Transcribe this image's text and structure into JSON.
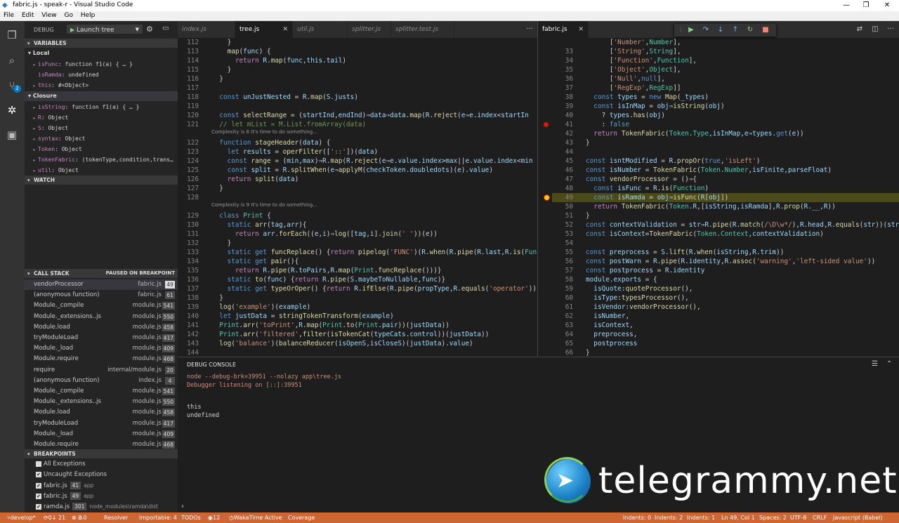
{
  "window": {
    "title": "fabric.js - speak-r - Visual Studio Code",
    "controls": [
      "—",
      "❐",
      "✕"
    ]
  },
  "menu": [
    "File",
    "Edit",
    "View",
    "Go",
    "Help"
  ],
  "debug": {
    "label": "DEBUG",
    "config": "Launch tree"
  },
  "variables": {
    "header": "VARIABLES",
    "local_label": "Local",
    "local": [
      {
        "name": "isFunc",
        "value": "function f1(a) { … }",
        "arrow": true
      },
      {
        "name": "isRamda",
        "value": "undefined",
        "arrow": false
      },
      {
        "name": "this",
        "value": "#<Object>",
        "arrow": true
      }
    ],
    "closure_label": "Closure",
    "closure": [
      {
        "name": "isString",
        "value": "function f1(a) { … }"
      },
      {
        "name": "R",
        "value": "Object"
      },
      {
        "name": "S",
        "value": "Object"
      },
      {
        "name": "syntax",
        "value": "Object"
      },
      {
        "name": "Token",
        "value": "Object"
      },
      {
        "name": "TokenFabric",
        "value": "(tokenType,condition,trans…"
      },
      {
        "name": "util",
        "value": "Object"
      }
    ]
  },
  "watch": {
    "header": "WATCH"
  },
  "callstack": {
    "header": "CALL STACK",
    "status": "PAUSED ON BREAKPOINT",
    "frames": [
      {
        "name": "vendorProcessor",
        "file": "fabric.js",
        "line": "49"
      },
      {
        "name": "(anonymous function)",
        "file": "fabric.js",
        "line": "61"
      },
      {
        "name": "Module._compile",
        "file": "module.js",
        "line": "541"
      },
      {
        "name": "Module._extensions..js",
        "file": "module.js",
        "line": "550"
      },
      {
        "name": "Module.load",
        "file": "module.js",
        "line": "458"
      },
      {
        "name": "tryModuleLoad",
        "file": "module.js",
        "line": "417"
      },
      {
        "name": "Module._load",
        "file": "module.js",
        "line": "409"
      },
      {
        "name": "Module.require",
        "file": "module.js",
        "line": "468"
      },
      {
        "name": "require",
        "file": "internal/module.js",
        "line": "20"
      },
      {
        "name": "(anonymous function)",
        "file": "index.js",
        "line": "4"
      },
      {
        "name": "Module._compile",
        "file": "module.js",
        "line": "541"
      },
      {
        "name": "Module._extensions..js",
        "file": "module.js",
        "line": "550"
      },
      {
        "name": "Module.load",
        "file": "module.js",
        "line": "458"
      },
      {
        "name": "tryModuleLoad",
        "file": "module.js",
        "line": "417"
      },
      {
        "name": "Module._load",
        "file": "module.js",
        "line": "409"
      },
      {
        "name": "Module.require",
        "file": "module.js",
        "line": "468"
      }
    ]
  },
  "breakpoints": {
    "header": "BREAKPOINTS",
    "items": [
      {
        "label": "All Exceptions",
        "checked": false,
        "line": "",
        "path": ""
      },
      {
        "label": "Uncaught Exceptions",
        "checked": true,
        "line": "",
        "path": ""
      },
      {
        "label": "fabric.js",
        "checked": true,
        "line": "41",
        "path": "app"
      },
      {
        "label": "fabric.js",
        "checked": true,
        "line": "49",
        "path": "app"
      },
      {
        "label": "ramda.js",
        "checked": true,
        "line": "301",
        "path": "node_modules\\ramda\\dist"
      }
    ]
  },
  "left_tabs": [
    "index.js",
    "tree.js",
    "util.js",
    "splitter.js",
    "splitter.test.js"
  ],
  "right_tabs": [
    "fabric.js"
  ],
  "left_lines": [
    {
      "n": "112",
      "code": "    }",
      "type": "code"
    },
    {
      "n": "113",
      "code": "    map(func) {",
      "type": "code"
    },
    {
      "n": "114",
      "code": "      return R.map(func,this.tail)",
      "type": "code"
    },
    {
      "n": "115",
      "code": "    }",
      "type": "code"
    },
    {
      "n": "116",
      "code": "  }",
      "type": "code"
    },
    {
      "n": "117",
      "code": "",
      "type": "code"
    },
    {
      "n": "118",
      "code": "  const unJustNested = R.map(S.justs)",
      "type": "code"
    },
    {
      "n": "119",
      "code": "",
      "type": "code"
    },
    {
      "n": "120",
      "code": "  const selectRange = (startInd,endInd)⇒data⇒data.map(R.reject(e⇒e.index<startIn",
      "type": "code"
    },
    {
      "n": "121",
      "code": "  // let mList = M.List.fromArray(data)",
      "type": "comment"
    },
    {
      "n": "",
      "code": "Complexity is 6 It's time to do something...",
      "type": "lens"
    },
    {
      "n": "122",
      "code": "  function stageHeader(data) {",
      "type": "code"
    },
    {
      "n": "123",
      "code": "    let results = operFilter(['::'])(data)",
      "type": "code"
    },
    {
      "n": "124",
      "code": "    const range = (min,max)⇒R.map(R.reject(e⇒e.value.index>max||e.value.index<min",
      "type": "code"
    },
    {
      "n": "125",
      "code": "    const split = R.splitWhen(e⇒applyM(checkToken.doubledots)(e).value)",
      "type": "code"
    },
    {
      "n": "126",
      "code": "    return split(data)",
      "type": "code"
    },
    {
      "n": "127",
      "code": "  }",
      "type": "code"
    },
    {
      "n": "128",
      "code": "",
      "type": "code"
    },
    {
      "n": "",
      "code": "Complexity is 9 It's time to do something...",
      "type": "lens"
    },
    {
      "n": "129",
      "code": "  class Print {",
      "type": "code"
    },
    {
      "n": "130",
      "code": "    static arr(tag,arr){",
      "type": "code"
    },
    {
      "n": "131",
      "code": "      return arr.forEach((e,i)⇒log([tag,i].join(' '))(e))",
      "type": "code"
    },
    {
      "n": "132",
      "code": "    }",
      "type": "code"
    },
    {
      "n": "133",
      "code": "    static get funcReplace() {return pipelog('FUNC')(R.when(R.pipe(R.last,R.is(Func",
      "type": "code"
    },
    {
      "n": "134",
      "code": "    static get pair(){",
      "type": "code"
    },
    {
      "n": "135",
      "code": "      return R.pipe(R.toPairs,R.map(Print.funcReplace()))}",
      "type": "code"
    },
    {
      "n": "136",
      "code": "    static to(func) {return R.pipe(S.maybeToNullable,func)}",
      "type": "code"
    },
    {
      "n": "137",
      "code": "    static get typeOrOper() {return R.ifElse(R.pipe(propType,R.equals('operator'))",
      "type": "code"
    },
    {
      "n": "138",
      "code": "  }",
      "type": "code"
    },
    {
      "n": "139",
      "code": "  log('example')(example)",
      "type": "code"
    },
    {
      "n": "140",
      "code": "  let justData = stringTokenTransform(example)",
      "type": "code"
    },
    {
      "n": "141",
      "code": "  Print.arr('toPrint',R.map(Print.to(Print.pair))(justData))",
      "type": "code"
    },
    {
      "n": "142",
      "code": "  Print.arr('filtered',filter(isTokenCat(typeCats.control))(justData))",
      "type": "code"
    },
    {
      "n": "143",
      "code": "  log('balance')(balanceReducer(isOpenS,isCloseS)(justData).value)",
      "type": "code"
    },
    {
      "n": "144",
      "code": "",
      "type": "code"
    }
  ],
  "right_lines": [
    {
      "n": "",
      "code": "      ['Number',Number],",
      "type": "code"
    },
    {
      "n": "33",
      "code": "      ['String',String],",
      "type": "code"
    },
    {
      "n": "34",
      "code": "      ['Function',Function],",
      "type": "code"
    },
    {
      "n": "35",
      "code": "      ['Object',Object],",
      "type": "code"
    },
    {
      "n": "36",
      "code": "      ['Null',null],",
      "type": "code"
    },
    {
      "n": "37",
      "code": "      ['RegExp',RegExp]]",
      "type": "code"
    },
    {
      "n": "38",
      "code": "  const types = new Map(_types)",
      "type": "code"
    },
    {
      "n": "39",
      "code": "  const isInMap = obj⇒isString(obj)",
      "type": "code"
    },
    {
      "n": "40",
      "code": "    ? types.has(obj)",
      "type": "code"
    },
    {
      "n": "41",
      "code": "    : false",
      "type": "code"
    },
    {
      "n": "42",
      "code": "  return TokenFabric(Token.Type,isInMap,e⇒types.get(e))",
      "type": "code"
    },
    {
      "n": "43",
      "code": "}",
      "type": "code"
    },
    {
      "n": "44",
      "code": "",
      "type": "code"
    },
    {
      "n": "45",
      "code": "const isntModified = R.propOr(true,'isLeft')",
      "type": "code"
    },
    {
      "n": "46",
      "code": "const isNumber = TokenFabric(Token.Number,isFinite,parseFloat)",
      "type": "code"
    },
    {
      "n": "47",
      "code": "const vendorProcessor = ()⇒{",
      "type": "code"
    },
    {
      "n": "48",
      "code": "  const isFunc = R.is(Function)",
      "type": "code"
    },
    {
      "n": "49",
      "code": "  const isRamda = obj⇒isFunc(R[obj])",
      "type": "current"
    },
    {
      "n": "50",
      "code": "  return TokenFabric(Token.R,[isString,isRamda],R.prop(R.__,R))",
      "type": "code"
    },
    {
      "n": "51",
      "code": "}",
      "type": "code"
    },
    {
      "n": "52",
      "code": "const contextValidation = str⇒R.pipe(R.match(/\\D\\w*/),R.head,R.equals(str))(str",
      "type": "code"
    },
    {
      "n": "53",
      "code": "const isContext=TokenFabric(Token.Context,contextValidation)",
      "type": "code"
    },
    {
      "n": "54",
      "code": "",
      "type": "code"
    },
    {
      "n": "55",
      "code": "const preprocess = S.lift(R.when(isString,R.trim))",
      "type": "code"
    },
    {
      "n": "56",
      "code": "const postWarn = R.pipe(R.identity,R.assoc('warning','left-sided value'))",
      "type": "code"
    },
    {
      "n": "57",
      "code": "const postprocess = R.identity",
      "type": "code"
    },
    {
      "n": "58",
      "code": "module.exports = {",
      "type": "code"
    },
    {
      "n": "59",
      "code": "  isQuote:quoteProcessor(),",
      "type": "code"
    },
    {
      "n": "60",
      "code": "  isType:typesProcessor(),",
      "type": "code"
    },
    {
      "n": "61",
      "code": "  isVendor:vendorProcessor(),",
      "type": "code"
    },
    {
      "n": "62",
      "code": "  isNumber,",
      "type": "code"
    },
    {
      "n": "63",
      "code": "  isContext,",
      "type": "code"
    },
    {
      "n": "64",
      "code": "  preprocess,",
      "type": "code"
    },
    {
      "n": "65",
      "code": "  postprocess",
      "type": "code"
    },
    {
      "n": "66",
      "code": "}",
      "type": "code"
    }
  ],
  "console": {
    "title": "DEBUG CONSOLE",
    "lines": [
      {
        "text": "node --debug-brk=39951 --nolazy app\\tree.js",
        "color": "#ce9178"
      },
      {
        "text": "Debugger listening on [::]:39951",
        "color": "#ce9178"
      },
      {
        "text": "",
        "color": "#d4d4d4"
      },
      {
        "text": "this",
        "color": "#d4d4d4"
      },
      {
        "text": "undefined",
        "color": "#d4d4d4"
      }
    ],
    "prompt": "›"
  },
  "watermark": {
    "text": "telegrammy.net"
  },
  "status": {
    "branch": "develop*",
    "sync": "0↓ 21",
    "errors": "0",
    "warnings": "0",
    "resolver": "Resolver",
    "importable": "Importable: 4",
    "todos": "TODOs",
    "todo_count": "12",
    "wakatime": "WakaTime Active",
    "coverage": "Coverage",
    "indents0": "Indents: 0",
    "indents2": "Indents: 2",
    "indents1": "Indents: 1",
    "position": "Ln 49, Col 1",
    "spaces": "Spaces: 2",
    "encoding": "UTF-8",
    "eol": "CRLF",
    "language": "Javascript (Babel)"
  },
  "colors": {
    "statusbar": "#cc6633",
    "activitybar": "#333333",
    "sidebar": "#252526",
    "editor": "#1e1e1e"
  }
}
